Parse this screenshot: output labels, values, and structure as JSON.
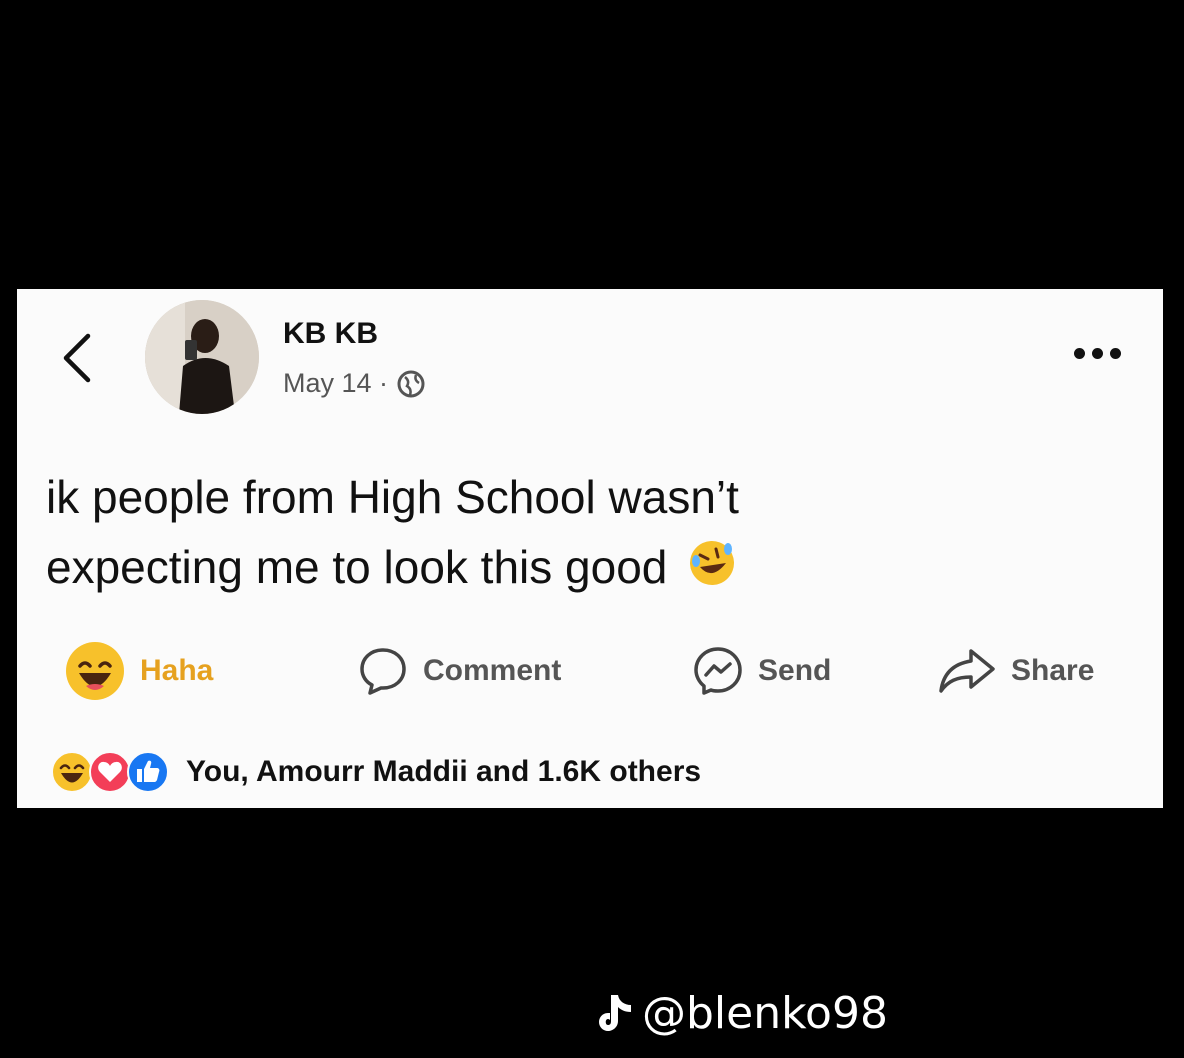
{
  "post": {
    "author": "KB KB",
    "date": "May 14 ·",
    "text_line1": "ik people from High School wasn’t",
    "text_line2": "expecting me to look this good"
  },
  "actions": {
    "haha": "Haha",
    "comment": "Comment",
    "send": "Send",
    "share": "Share"
  },
  "reactions": {
    "summary": "You, Amourr Maddii and 1.6K others"
  },
  "watermark": {
    "handle": "@blenko98"
  },
  "icons": {
    "back": "chevron-left-icon",
    "privacy": "globe-icon",
    "more": "more-options-icon",
    "haha": "haha-reaction-icon",
    "comment": "comment-bubble-icon",
    "send": "messenger-icon",
    "share": "share-arrow-icon",
    "love": "love-reaction-icon",
    "like": "like-reaction-icon",
    "tiktok": "tiktok-note-icon",
    "rofl": "rofl-emoji-icon"
  },
  "colors": {
    "haha_label": "#e6a11f",
    "love": "#f33e58",
    "like": "#1877f2"
  }
}
